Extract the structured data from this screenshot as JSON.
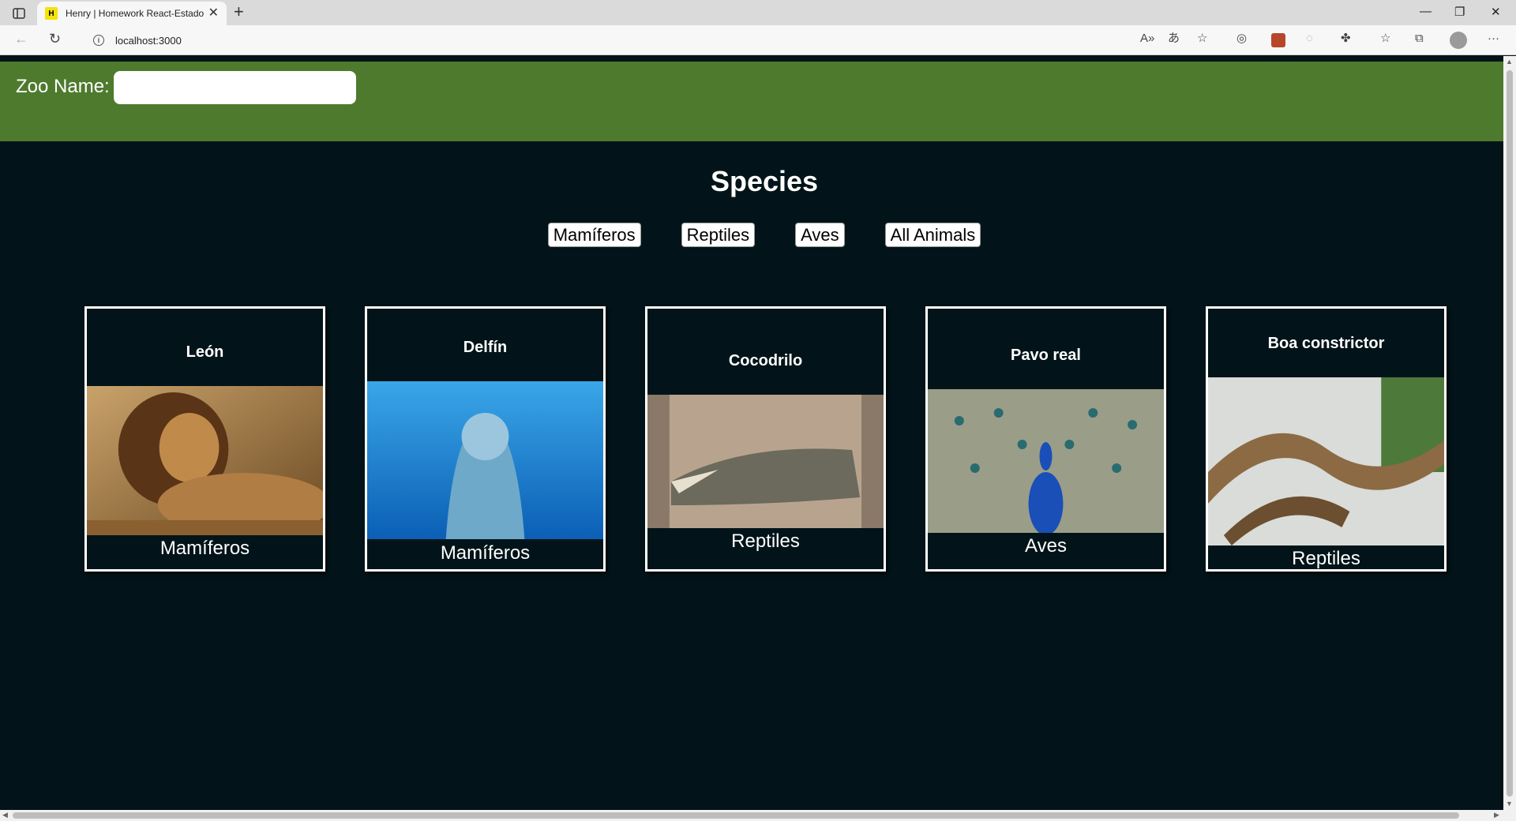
{
  "browser": {
    "tab_title": "Henry | Homework React-Estado",
    "favicon_text": "H",
    "url": "localhost:3000",
    "icons": [
      "sidebar-icon",
      "close-icon",
      "new-tab-icon",
      "minimize-icon",
      "restore-icon",
      "window-close-icon",
      "back-icon",
      "refresh-icon",
      "info-icon",
      "read-aloud-icon",
      "translate-icon",
      "add-favorite-icon",
      "tracking-icon",
      "extension-icon",
      "extensions-icon",
      "favorites-icon",
      "collections-icon",
      "profile-icon",
      "more-icon"
    ]
  },
  "header": {
    "zoo_label": "Zoo Name:",
    "zoo_input_value": "",
    "background": "#4e7a2e"
  },
  "species": {
    "title": "Species",
    "filters": [
      "Mamíferos",
      "Reptiles",
      "Aves",
      "All Animals"
    ]
  },
  "animals": [
    {
      "name": "León",
      "species": "Mamíferos"
    },
    {
      "name": "Delfín",
      "species": "Mamíferos"
    },
    {
      "name": "Cocodrilo",
      "species": "Reptiles"
    },
    {
      "name": "Pavo real",
      "species": "Aves"
    },
    {
      "name": "Boa constrictor",
      "species": "Reptiles"
    }
  ],
  "colors": {
    "page_bg": "#021419",
    "card_border": "#ffffff",
    "text": "#ffffff"
  }
}
